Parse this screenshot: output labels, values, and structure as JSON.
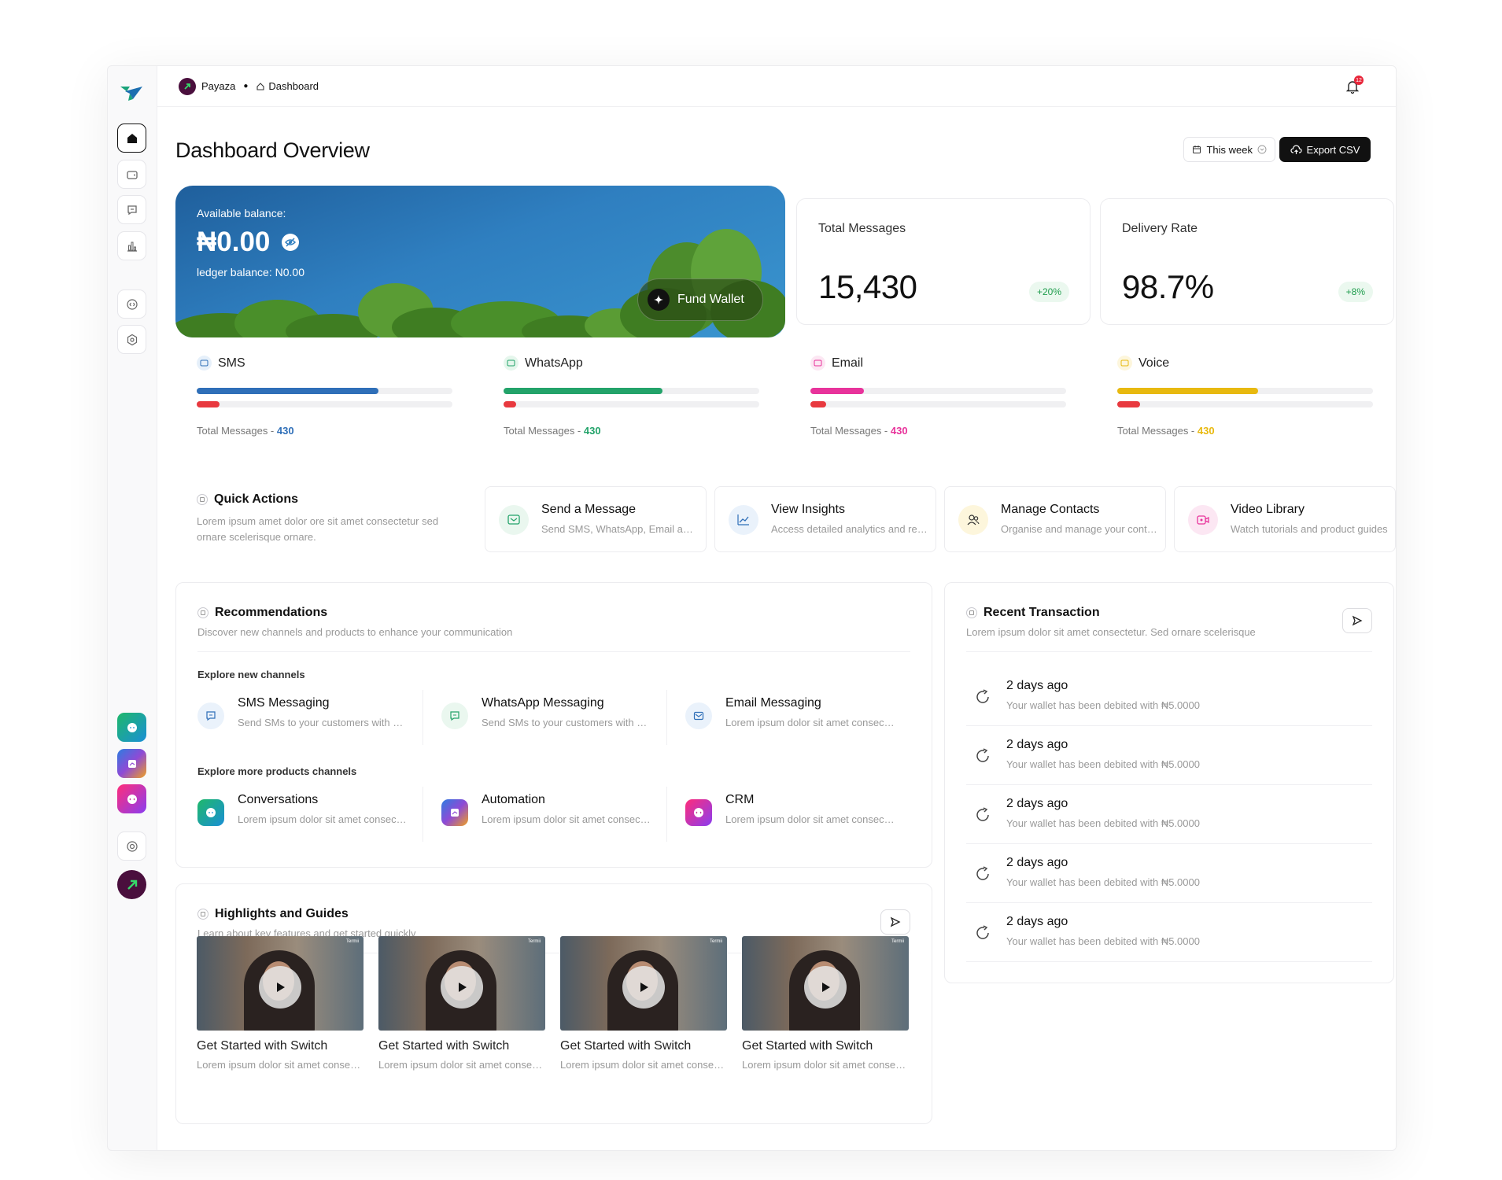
{
  "breadcrumb": {
    "org": "Payaza",
    "page": "Dashboard"
  },
  "notifications": {
    "count": "12"
  },
  "header": {
    "title": "Dashboard Overview",
    "range_label": "This week",
    "export_label": "Export CSV"
  },
  "balance": {
    "label": "Available balance:",
    "amount": "₦0.00",
    "ledger": "ledger balance: N0.00",
    "fund_label": "Fund Wallet"
  },
  "stats": [
    {
      "title": "Total Messages",
      "value": "15,430",
      "change": "+20%"
    },
    {
      "title": "Delivery Rate",
      "value": "98.7%",
      "change": "+8%"
    }
  ],
  "channels": [
    {
      "name": "SMS",
      "total_label": "Total Messages - ",
      "total": "430",
      "progress": 0.71,
      "failed": 0.09,
      "color": "#2f6fb8"
    },
    {
      "name": "WhatsApp",
      "total_label": "Total Messages - ",
      "total": "430",
      "progress": 0.62,
      "failed": 0.05,
      "color": "#23a36a"
    },
    {
      "name": "Email",
      "total_label": "Total Messages - ",
      "total": "430",
      "progress": 0.21,
      "failed": 0.06,
      "color": "#e8339b"
    },
    {
      "name": "Voice",
      "total_label": "Total Messages - ",
      "total": "430",
      "progress": 0.55,
      "failed": 0.09,
      "color": "#e8b90f"
    }
  ],
  "quick_actions": {
    "title": "Quick Actions",
    "description": "Lorem ipsum amet dolor ore sit amet consectetur sed ornare scelerisque ornare.",
    "items": [
      {
        "title": "Send a Message",
        "subtitle": "Send SMS, WhatsApp, Email and more"
      },
      {
        "title": "View Insights",
        "subtitle": "Access detailed analytics and reports"
      },
      {
        "title": "Manage Contacts",
        "subtitle": "Organise and manage your contacts"
      },
      {
        "title": "Video Library",
        "subtitle": "Watch tutorials and product guides"
      }
    ]
  },
  "recommendations": {
    "title": "Recommendations",
    "description": "Discover new channels and products to enhance your communication",
    "new_channels_title": "Explore new channels",
    "new_channels": [
      {
        "title": "SMS Messaging",
        "subtitle": "Send SMs to your customers with ease"
      },
      {
        "title": "WhatsApp Messaging",
        "subtitle": "Send SMs to your customers with ease"
      },
      {
        "title": "Email Messaging",
        "subtitle": "Lorem ipsum dolor sit amet consectetur"
      }
    ],
    "more_products_title": "Explore more products channels",
    "more_products": [
      {
        "title": "Conversations",
        "subtitle": "Lorem ipsum dolor sit amet consectetur"
      },
      {
        "title": "Automation",
        "subtitle": "Lorem ipsum dolor sit amet consectetur"
      },
      {
        "title": "CRM",
        "subtitle": "Lorem ipsum dolor sit amet consectetur"
      }
    ]
  },
  "highlights": {
    "title": "Highlights and Guides",
    "description": "Learn about key features and get started quickly",
    "watermark": "Termii",
    "videos": [
      {
        "title": "Get Started with  Switch",
        "subtitle": "Lorem ipsum dolor sit amet consectetur"
      },
      {
        "title": "Get Started with  Switch",
        "subtitle": "Lorem ipsum dolor sit amet consectetur"
      },
      {
        "title": "Get Started with  Switch",
        "subtitle": "Lorem ipsum dolor sit amet consectetur"
      },
      {
        "title": "Get Started with  Switch",
        "subtitle": "Lorem ipsum dolor sit amet consectetur"
      }
    ]
  },
  "transactions": {
    "title": "Recent Transaction",
    "description": "Lorem ipsum dolor sit amet consectetur. Sed ornare scelerisque",
    "items": [
      {
        "time": "2 days ago",
        "text": "Your wallet has been debited with ₦5.0000"
      },
      {
        "time": "2 days ago",
        "text": "Your wallet has been debited with ₦5.0000"
      },
      {
        "time": "2 days ago",
        "text": "Your wallet has been debited with ₦5.0000"
      },
      {
        "time": "2 days ago",
        "text": "Your wallet has been debited with ₦5.0000"
      },
      {
        "time": "2 days ago",
        "text": "Your wallet has been debited with ₦5.0000"
      }
    ]
  }
}
